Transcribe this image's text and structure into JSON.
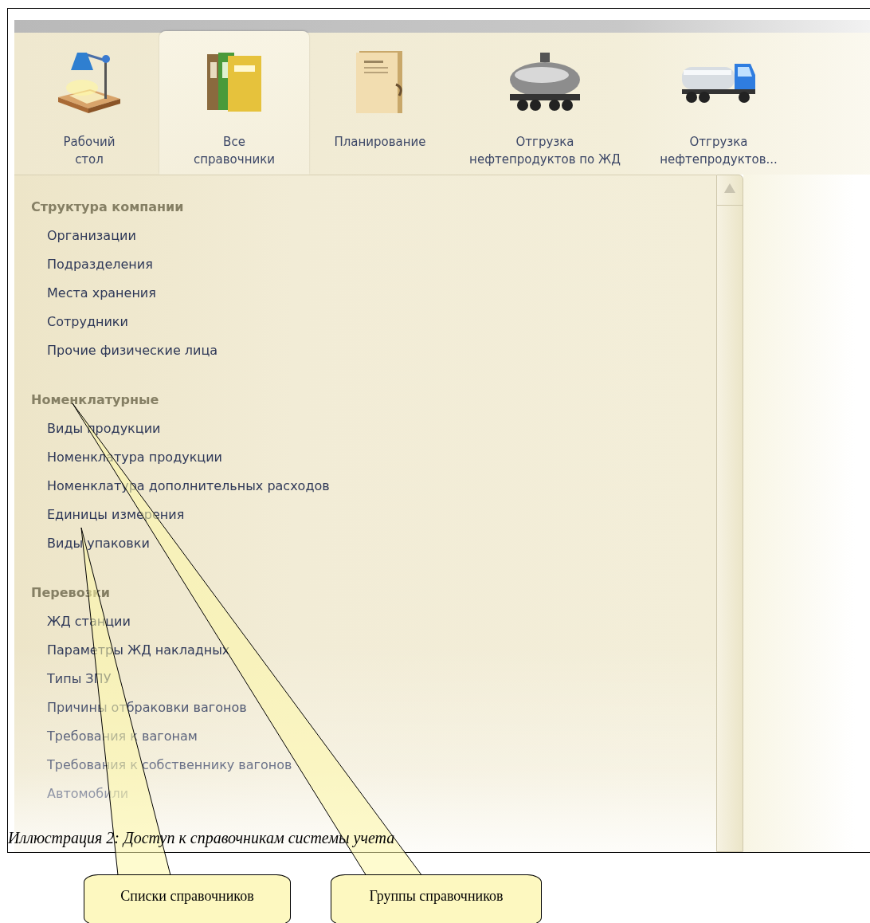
{
  "tabs": [
    {
      "label": "Рабочий\nстол",
      "kind": "lamp",
      "selected": false
    },
    {
      "label": "Все\nсправочники",
      "kind": "folders",
      "selected": true
    },
    {
      "label": "Планирование",
      "kind": "document",
      "selected": false
    },
    {
      "label": "Отгрузка\nнефтепродуктов по ЖД",
      "kind": "tank",
      "selected": false
    },
    {
      "label": "Отгрузка\nнефтепродуктов...",
      "kind": "truck",
      "selected": false
    }
  ],
  "groups": [
    {
      "title": "Структура компании",
      "items": [
        "Организации",
        "Подразделения",
        "Места хранения",
        "Сотрудники",
        "Прочие физические лица"
      ]
    },
    {
      "title": "Номенклатурные",
      "items": [
        "Виды продукции",
        "Номенклатура продукции",
        "Номенклатура дополнительных расходов",
        "Единицы измерения",
        "Виды упаковки"
      ]
    },
    {
      "title": "Перевозки",
      "items": [
        "ЖД станции",
        "Параметры ЖД накладных",
        "Типы ЗПУ",
        "Причины отбраковки вагонов",
        "Требования к вагонам",
        "Требования к собственнику вагонов",
        "Автомобили"
      ]
    }
  ],
  "caption": "Иллюстрация 2: Доступ к справочникам системы учета",
  "callouts": [
    "Списки справочников",
    "Группы справочников"
  ]
}
